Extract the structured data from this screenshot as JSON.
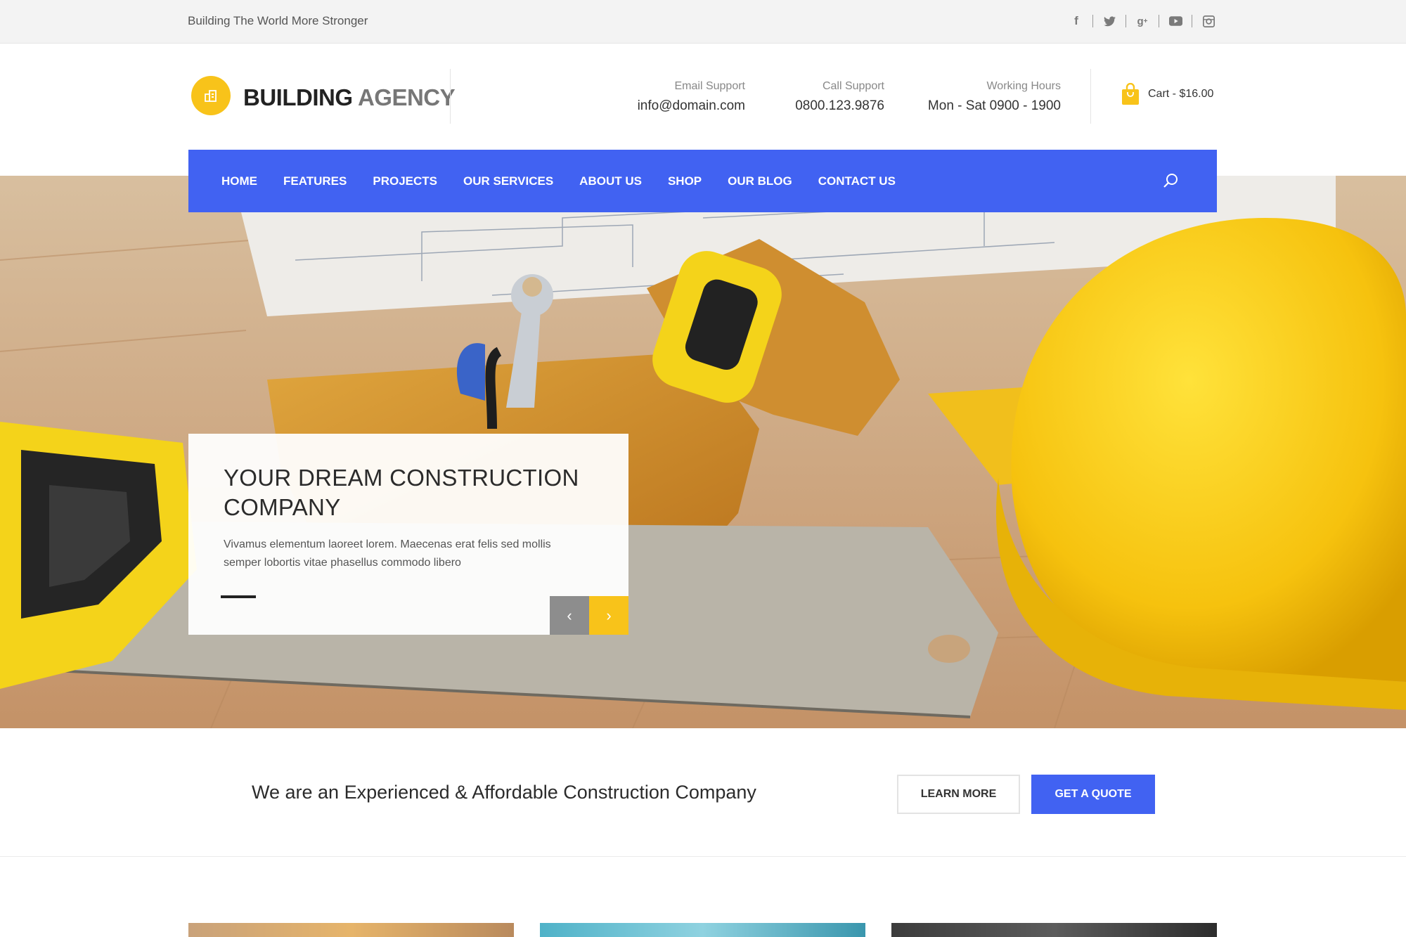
{
  "topbar": {
    "tagline": "Building The World More Stronger",
    "socials": [
      "facebook-icon",
      "twitter-icon",
      "google-plus-icon",
      "youtube-icon",
      "instagram-icon"
    ]
  },
  "header": {
    "logo_bold": "BUILDING",
    "logo_light": "AGENCY",
    "email_label": "Email Support",
    "email_value": "info@domain.com",
    "call_label": "Call Support",
    "call_value": "0800.123.9876",
    "hours_label": "Working Hours",
    "hours_value": "Mon - Sat 0900 - 1900",
    "cart_label": "Cart - $16.00"
  },
  "nav": {
    "items": [
      "HOME",
      "FEATURES",
      "PROJECTS",
      "OUR SERVICES",
      "ABOUT US",
      "SHOP",
      "OUR BLOG",
      "CONTACT US"
    ]
  },
  "hero": {
    "title": "YOUR DREAM CONSTRUCTION COMPANY",
    "text": "Vivamus elementum laoreet lorem. Maecenas erat felis sed mollis semper lobortis vitae phasellus commodo libero",
    "prev_icon": "chevron-left-icon",
    "next_icon": "chevron-right-icon"
  },
  "cta": {
    "text": "We are an Experienced & Affordable Construction Company",
    "learn_more": "LEARN MORE",
    "get_quote": "GET A QUOTE"
  },
  "colors": {
    "accent_blue": "#4162f2",
    "accent_yellow": "#f8c31a"
  }
}
